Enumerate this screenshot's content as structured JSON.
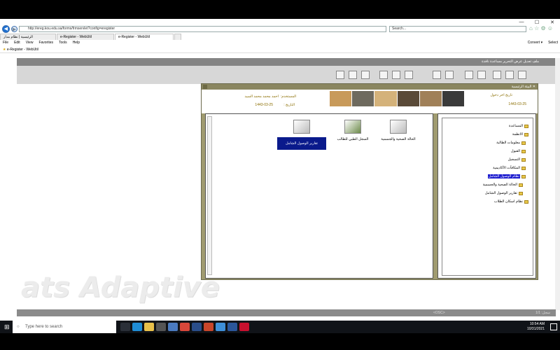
{
  "window": {
    "controls": [
      "—",
      "☐",
      "✕"
    ]
  },
  "browser": {
    "address": "http://ereg.kou.edu.sa/forms/frmservlet?config=eregister",
    "search_placeholder": "Search...",
    "tabs": [
      {
        "label": "الرئيسية | نظام مدار"
      },
      {
        "label": "e-Register - WebUtil"
      },
      {
        "label": "e-Register - WebUtil"
      }
    ],
    "menus": [
      "File",
      "Edit",
      "View",
      "Favorites",
      "Tools",
      "Help"
    ],
    "right_tools": [
      "Convert ▾",
      "Select"
    ],
    "favorites_item": "e-Register - WebUtil"
  },
  "app": {
    "header_menu": "ملف  تعديل  عرض  التحرير  مساعدة  نافذة",
    "dialog_title": "البيئة الرئيسية",
    "last_login_label": "تاريخ اخر دخول",
    "last_login_value": "1443-03-25",
    "user_label": "المستخدم:",
    "user_value": "احمد محمد محمد السيد",
    "date_label": "التاريخ :",
    "date_value": "1443-03-25",
    "status_text": "<OSC>",
    "status_record": "سجل: 1/1"
  },
  "tree": [
    {
      "label": "المساعدة",
      "selected": false
    },
    {
      "label": "الانظمة",
      "selected": false
    },
    {
      "label": "معلومات الطالبة",
      "selected": false
    },
    {
      "label": "القبول",
      "selected": false
    },
    {
      "label": "التسجيل",
      "selected": false
    },
    {
      "label": "المكافآت الأكاديمية",
      "selected": false
    },
    {
      "label": "نظام الوصول الشامل",
      "selected": true
    },
    {
      "label": "الحالة الصحية والجسمية",
      "selected": false
    },
    {
      "label": "تقارير الوصول الشامل",
      "selected": false
    },
    {
      "label": "نظام اسكان الطلاب",
      "selected": false
    }
  ],
  "cards": [
    {
      "label": "الحالة الصحية والجسمية",
      "selected": false
    },
    {
      "label": "السجل الطبي للطالب",
      "selected": false
    },
    {
      "label": "تقارير الوصول الشامل",
      "selected": true
    }
  ],
  "watermark": "ats Adaptive",
  "taskbar": {
    "search_placeholder": "Type here to search",
    "time": "10:54 AM",
    "date": "10/31/2021"
  }
}
